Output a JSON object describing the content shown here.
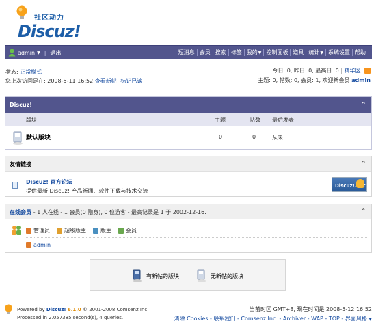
{
  "logo": {
    "cn": "社区动力",
    "en": "Discuz!"
  },
  "nav": {
    "username": "admin",
    "logout": "退出",
    "items": [
      "短消息",
      "会员",
      "搜索",
      "标签",
      "我的",
      "控制面板",
      "道具",
      "统计",
      "系统设置",
      "帮助"
    ],
    "caret_items": [
      4,
      7
    ]
  },
  "status": {
    "mode_label": "状态:",
    "mode_value": "正常模式",
    "last_visit": "您上次访问是在: 2008-5-11 16:52",
    "view_new": "查看新帖",
    "mark_read": "标记已读",
    "today_stats": "今日: 0, 昨日: 0, 最高日: 0",
    "digest": "精华区",
    "topic_stats": "主题: 0, 帖数: 0, 会员: 1, 欢迎新会员",
    "new_member": "admin"
  },
  "forum": {
    "category": "Discuz!",
    "collapse": "^",
    "headers": {
      "board": "版块",
      "topics": "主题",
      "posts": "帖数",
      "last_post": "最后发表"
    },
    "rows": [
      {
        "name": "默认版块",
        "topics": "0",
        "posts": "0",
        "last_post": "从未"
      }
    ]
  },
  "friend_links": {
    "title": "友情链接",
    "collapse": "^",
    "site_name": "Discuz! 官方论坛",
    "site_desc": "提供最新 Discuz! 产品新闻、软件下载与技术交流",
    "logo_text": "Discuz!.net"
  },
  "online": {
    "title": "在线会员",
    "desc": " - 1 人在线 - 1 会员(0 隐身), 0 位游客 - 最高记录是 1 于 2002-12-16.",
    "collapse": "^",
    "legend": [
      {
        "label": "管理员",
        "color": "#e07a2a"
      },
      {
        "label": "超级版主",
        "color": "#e0a030"
      },
      {
        "label": "版主",
        "color": "#4a90c0"
      },
      {
        "label": "会员",
        "color": "#6aa84f"
      }
    ],
    "members": [
      "admin"
    ]
  },
  "icon_legend": {
    "new": "有新帖的版块",
    "none": "无新帖的版块"
  },
  "footer": {
    "powered_by": "Powered by",
    "product": "Discuz!",
    "version": "6.1.0",
    "copyright": "© 2001-2008 Comsenz Inc.",
    "processed": "Processed in 2.057385 second(s), 4 queries.",
    "timezone": "当前时区  GMT+8, 现在时间是  2008-5-12 16:52",
    "links": "清除 Cookies - 联系我们 - Comsenz Inc. - Archiver - WAP - TOP - 界面风格"
  }
}
